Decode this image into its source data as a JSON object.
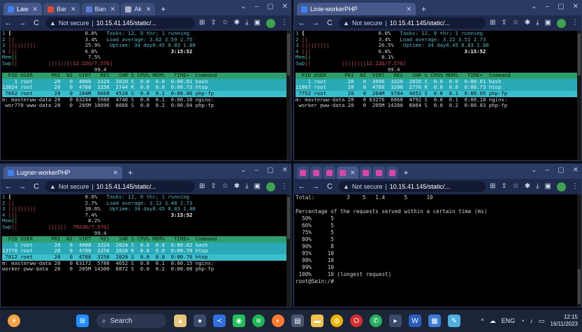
{
  "windows": [
    {
      "tabs": [
        {
          "label": "Law",
          "color": "#3b82f6",
          "active": true
        },
        {
          "label": "Bar",
          "color": "#e5462e",
          "active": false
        },
        {
          "label": "Ban",
          "color": "#5b7bd6",
          "active": false
        },
        {
          "label": "Ak",
          "color": "#aab3c7",
          "active": false
        }
      ],
      "address": {
        "warning": "Not secure",
        "url": "10.15.41.145/static/..."
      },
      "htop": {
        "cpu": [
          {
            "n": "1",
            "bar": "[",
            "pct": "0.0%"
          },
          {
            "n": "2",
            "bar": "[|",
            "pct": "3.4%"
          },
          {
            "n": "3",
            "bar": "[||||||||",
            "pct": "25.9%"
          },
          {
            "n": "4",
            "bar": "[||",
            "pct": "6.8%"
          }
        ],
        "mem": {
          "bar": "[|",
          "pct": "7.5%"
        },
        "swp": {
          "bar": "[|",
          "val": "||||||||12.22G/7.57G]"
        },
        "tasks": "Tasks: 12, 0 thr; 1 running",
        "load": "Load average: 3.62 3.59 2.75",
        "uptime": "Uptime: 34 day0.45 0.83 1.80",
        "time": "3:15:52",
        "extra": "99.4",
        "header": "  PID USER      PRI  NI  VIRT   RES   SHR S CPU% MEM%   TIME+  Command",
        "rows": [
          {
            "text": "    1 root       20   0  4000  3324  2820 S  0.0  0.0  0:00.01 bash",
            "cls": "hl-cyan"
          },
          {
            "text": "13824 root       20   0  4788  3256  2744 R  0.0  0.0  0:00.73 htop",
            "cls": "hl-cyan"
          },
          {
            "text": " 7692 root       20   0  204M  9668  4528 S  0.0  0.1  0:00.06 php-fp",
            "cls": "hl-sel"
          },
          {
            "text": "m: masterww-data 20   0 63244  5980  4740 S  0.0  0.1  0:00.10 nginx:",
            "cls": ""
          },
          {
            "text": " wor770 www-data 20   0  205M 10096  8668 S  0.0  0.2  0:00.04 php-fp",
            "cls": ""
          }
        ]
      }
    },
    {
      "tabs": [
        {
          "label": "Linie-workerPHP",
          "color": "#3b82f6",
          "active": true
        }
      ],
      "address": {
        "warning": "Not secure",
        "url": "10.15.41.145/static/..."
      },
      "htop": {
        "cpu": [
          {
            "n": "1",
            "bar": "[",
            "pct": "0.0%"
          },
          {
            "n": "2",
            "bar": "[|",
            "pct": "3.4%"
          },
          {
            "n": "3",
            "bar": "[||||||||",
            "pct": "26.5%"
          },
          {
            "n": "4",
            "bar": "[||",
            "pct": "6.8%"
          }
        ],
        "mem": {
          "bar": "[|",
          "pct": "8.1%"
        },
        "swp": {
          "bar": "[|",
          "val": "||||||||12.22G/7.57G]"
        },
        "tasks": "Tasks: 12, 0 thr; 1 running",
        "load": "Load average: 3.22 3.51 2.73",
        "uptime": "Uptime: 34 day0.45 0.83 1.80",
        "time": "3:15:52",
        "extra": "99.4",
        "header": "  PID USER      PRI  NI  VIRT   RES   SHR S CPU% MEM%   TIME+  Command",
        "rows": [
          {
            "text": "    1 root       20   0  3996  3320  2820 S  0.0  0.0  0:00.01 bash",
            "cls": "hl-cyan"
          },
          {
            "text": "11867 root       20   0  4788  3200  2776 R  0.0  0.0  0:00.73 htop",
            "cls": "hl-cyan"
          },
          {
            "text": " 7752 root       20   0  204M  9784  4652 S  0.0  0.1  0:00.05 php-fp",
            "cls": "hl-sel"
          },
          {
            "text": "m: masterww-data 20   0 63276  6068  4792 S  0.0  0.1  0:00.10 nginx:",
            "cls": ""
          },
          {
            "text": " worker pww-data 20   0  205M 14288  8864 S  0.0  0.2  0:00.03 php-fp",
            "cls": ""
          }
        ]
      }
    },
    {
      "tabs": [
        {
          "label": "Lugner-workerPHP",
          "color": "#3b82f6",
          "active": true
        }
      ],
      "address": {
        "warning": "Not secure",
        "url": "10.15.41.145/static/..."
      },
      "htop": {
        "cpu": [
          {
            "n": "1",
            "bar": "[",
            "pct": "0.0%"
          },
          {
            "n": "2",
            "bar": "[|",
            "pct": "2.7%"
          },
          {
            "n": "3",
            "bar": "[||||||||",
            "pct": "30.6%"
          },
          {
            "n": "4",
            "bar": "[||",
            "pct": "7.4%"
          }
        ],
        "mem": {
          "bar": "[|",
          "pct": "8.2%"
        },
        "swp": {
          "bar": "[|",
          "val": "||||||  7923G/7.57G]"
        },
        "tasks": "Tasks: 12, 0 thr; 1 running",
        "load": "Load average: 3.12 3.48 2.73",
        "uptime": "Uptime: 34 day0.45 0.83 1.80",
        "time": "3:15:52",
        "extra": "99.4",
        "header": "  PID USER      PRI  NI  VIRT   RES   SHR S CPU% MEM%   TIME+  Command",
        "rows": [
          {
            "text": "    1 root       20   0  4000  3324  2824 S  0.0  0.0  0:00.02 bash",
            "cls": "hl-cyan"
          },
          {
            "text": "13770 root       20   0  4788  3256  2828 R  0.0  0.0  0:00.70 htop",
            "cls": "hl-cyan"
          },
          {
            "text": " 7812 root       20   0  4788  3256  2828 S  0.0  0.0  0:00.70 htop",
            "cls": "hl-sel"
          },
          {
            "text": "m: masterww-data 20   0 63172  5780  4652 S  0.0  0.1  0:00.15 nginx:",
            "cls": ""
          },
          {
            "text": "worker pww-data  20   0  205M 14300  8872 S  0.0  0.2  0:00.08 php-fp",
            "cls": ""
          }
        ]
      }
    },
    {
      "tabs": [
        {
          "label": "",
          "color": "#d946a8",
          "active": false
        },
        {
          "label": "",
          "color": "#d946a8",
          "active": false
        },
        {
          "label": "",
          "color": "#d946a8",
          "active": false
        },
        {
          "label": "",
          "color": "#d946a8",
          "active": true
        },
        {
          "label": "",
          "color": "#d946a8",
          "active": false
        },
        {
          "label": "",
          "color": "#d946a8",
          "active": false
        },
        {
          "label": "",
          "color": "#d946a8",
          "active": false
        }
      ],
      "address": {
        "warning": "Not secure",
        "url": "10.15.41.145/static/..."
      },
      "ab": {
        "total": "Total:          3    5   1.4      5      10",
        "blank": "",
        "title": "Percentage of the requests served within a certain time (ms)",
        "rows": [
          "  50%      5",
          "  66%      5",
          "  75%      5",
          "  80%      5",
          "  90%      8",
          "  95%     10",
          "  98%     10",
          "  99%     10",
          " 100%     10 (longest request)"
        ],
        "prompt": "root@Sein:/#"
      }
    }
  ],
  "taskbar": {
    "search_label": "Search",
    "lang": "ENG",
    "time": "12:15",
    "date": "16/11/2023"
  }
}
